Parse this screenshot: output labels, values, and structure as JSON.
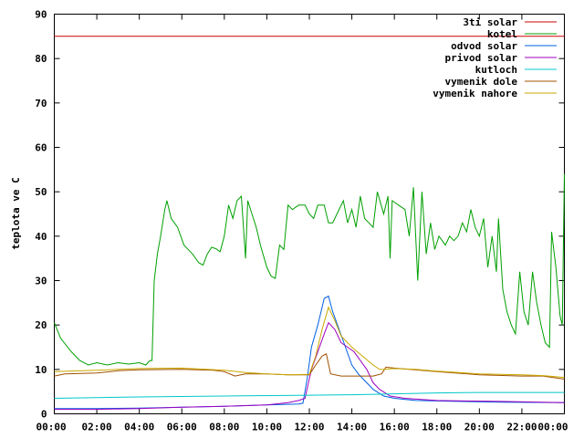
{
  "chart_data": {
    "type": "line",
    "title": "",
    "xlabel": "",
    "ylabel": "teplota ve C",
    "xlim": [
      0,
      24
    ],
    "ylim": [
      0,
      90
    ],
    "grid": false,
    "legend_position": "top-right",
    "x_ticks": [
      {
        "value": 0,
        "label": "00:00"
      },
      {
        "value": 2,
        "label": "02:00"
      },
      {
        "value": 4,
        "label": "04:00"
      },
      {
        "value": 6,
        "label": "06:00"
      },
      {
        "value": 8,
        "label": "08:00"
      },
      {
        "value": 10,
        "label": "10:00"
      },
      {
        "value": 12,
        "label": "12:00"
      },
      {
        "value": 14,
        "label": "14:00"
      },
      {
        "value": 16,
        "label": "16:00"
      },
      {
        "value": 18,
        "label": "18:00"
      },
      {
        "value": 20,
        "label": "20:00"
      },
      {
        "value": 22,
        "label": "22:00"
      },
      {
        "value": 24,
        "label": "00:00"
      }
    ],
    "y_ticks": [
      {
        "value": 0,
        "label": "0"
      },
      {
        "value": 10,
        "label": "10"
      },
      {
        "value": 20,
        "label": "20"
      },
      {
        "value": 30,
        "label": "30"
      },
      {
        "value": 40,
        "label": "40"
      },
      {
        "value": 50,
        "label": "50"
      },
      {
        "value": 60,
        "label": "60"
      },
      {
        "value": 70,
        "label": "70"
      },
      {
        "value": 80,
        "label": "80"
      },
      {
        "value": 90,
        "label": "90"
      }
    ],
    "series": [
      {
        "name": "3ti solar",
        "color": "#cc0000",
        "points": [
          [
            0,
            85
          ],
          [
            24,
            85
          ]
        ]
      },
      {
        "name": "kotel",
        "color": "#00a000",
        "points": [
          [
            0,
            20.5
          ],
          [
            0.3,
            17
          ],
          [
            0.8,
            14
          ],
          [
            1.2,
            12
          ],
          [
            1.6,
            11
          ],
          [
            2,
            11.5
          ],
          [
            2.5,
            11
          ],
          [
            3,
            11.5
          ],
          [
            3.5,
            11.2
          ],
          [
            4,
            11.5
          ],
          [
            4.3,
            11
          ],
          [
            4.5,
            12
          ],
          [
            4.6,
            12
          ],
          [
            4.7,
            30
          ],
          [
            4.85,
            36
          ],
          [
            5,
            40
          ],
          [
            5.2,
            46
          ],
          [
            5.3,
            48
          ],
          [
            5.5,
            44
          ],
          [
            5.8,
            42
          ],
          [
            6.1,
            38
          ],
          [
            6.5,
            36
          ],
          [
            6.8,
            34
          ],
          [
            7,
            33.5
          ],
          [
            7.2,
            36
          ],
          [
            7.4,
            37.5
          ],
          [
            7.6,
            37.2
          ],
          [
            7.8,
            36.5
          ],
          [
            8,
            40
          ],
          [
            8.2,
            47
          ],
          [
            8.4,
            44
          ],
          [
            8.6,
            48
          ],
          [
            8.8,
            49
          ],
          [
            9,
            35
          ],
          [
            9.1,
            48
          ],
          [
            9.3,
            45
          ],
          [
            9.5,
            42
          ],
          [
            9.7,
            38
          ],
          [
            10,
            33
          ],
          [
            10.2,
            31
          ],
          [
            10.4,
            30.5
          ],
          [
            10.6,
            38
          ],
          [
            10.8,
            37
          ],
          [
            11,
            47
          ],
          [
            11.2,
            46
          ],
          [
            11.5,
            47
          ],
          [
            11.8,
            47
          ],
          [
            12,
            45
          ],
          [
            12.2,
            44
          ],
          [
            12.4,
            47
          ],
          [
            12.7,
            47
          ],
          [
            12.9,
            43
          ],
          [
            13.1,
            43
          ],
          [
            13.4,
            46
          ],
          [
            13.6,
            48
          ],
          [
            13.8,
            43
          ],
          [
            14,
            46
          ],
          [
            14.2,
            42
          ],
          [
            14.4,
            49
          ],
          [
            14.6,
            44
          ],
          [
            14.8,
            43
          ],
          [
            15,
            42
          ],
          [
            15.2,
            50
          ],
          [
            15.5,
            45
          ],
          [
            15.7,
            49
          ],
          [
            15.8,
            35
          ],
          [
            15.9,
            48
          ],
          [
            16.2,
            47
          ],
          [
            16.5,
            46
          ],
          [
            16.7,
            40
          ],
          [
            16.9,
            51
          ],
          [
            17.1,
            30
          ],
          [
            17.3,
            50
          ],
          [
            17.5,
            36
          ],
          [
            17.7,
            43
          ],
          [
            17.9,
            37
          ],
          [
            18.1,
            40
          ],
          [
            18.4,
            38
          ],
          [
            18.6,
            40
          ],
          [
            18.8,
            39
          ],
          [
            19,
            40
          ],
          [
            19.2,
            43
          ],
          [
            19.4,
            41
          ],
          [
            19.6,
            46
          ],
          [
            19.8,
            42
          ],
          [
            20,
            40
          ],
          [
            20.2,
            44
          ],
          [
            20.4,
            33
          ],
          [
            20.6,
            40
          ],
          [
            20.8,
            32
          ],
          [
            20.9,
            44
          ],
          [
            21.1,
            28
          ],
          [
            21.3,
            23
          ],
          [
            21.5,
            20
          ],
          [
            21.7,
            18
          ],
          [
            21.9,
            32
          ],
          [
            22.1,
            23
          ],
          [
            22.3,
            20
          ],
          [
            22.5,
            32
          ],
          [
            22.7,
            25
          ],
          [
            22.9,
            20
          ],
          [
            23.1,
            16
          ],
          [
            23.3,
            15
          ],
          [
            23.4,
            41
          ],
          [
            23.6,
            33
          ],
          [
            23.8,
            22
          ],
          [
            23.9,
            20
          ],
          [
            24,
            54
          ]
        ]
      },
      {
        "name": "odvod solar",
        "color": "#0060e0",
        "points": [
          [
            0,
            1.2
          ],
          [
            2,
            1.2
          ],
          [
            4,
            1.3
          ],
          [
            6,
            1.5
          ],
          [
            8,
            1.7
          ],
          [
            10,
            2
          ],
          [
            11.5,
            2.2
          ],
          [
            11.7,
            2.4
          ],
          [
            11.9,
            8
          ],
          [
            12.1,
            15
          ],
          [
            12.4,
            20
          ],
          [
            12.7,
            26
          ],
          [
            12.9,
            26.5
          ],
          [
            13.1,
            23
          ],
          [
            13.4,
            19
          ],
          [
            13.7,
            15
          ],
          [
            14,
            11
          ],
          [
            14.3,
            9
          ],
          [
            14.6,
            7.5
          ],
          [
            15,
            5.5
          ],
          [
            15.5,
            4
          ],
          [
            16,
            3.5
          ],
          [
            17,
            3
          ],
          [
            19,
            2.8
          ],
          [
            21,
            2.6
          ],
          [
            24,
            2.5
          ]
        ]
      },
      {
        "name": "privod solar",
        "color": "#a000c0",
        "points": [
          [
            0,
            1
          ],
          [
            2,
            1
          ],
          [
            4,
            1.2
          ],
          [
            6,
            1.5
          ],
          [
            8,
            1.7
          ],
          [
            10,
            2
          ],
          [
            11,
            2.5
          ],
          [
            11.5,
            3
          ],
          [
            11.8,
            3.5
          ],
          [
            12.1,
            10
          ],
          [
            12.4,
            14
          ],
          [
            12.7,
            18
          ],
          [
            12.9,
            20.5
          ],
          [
            13.2,
            19
          ],
          [
            13.5,
            16
          ],
          [
            13.8,
            15
          ],
          [
            14.1,
            14
          ],
          [
            14.4,
            12
          ],
          [
            14.7,
            10
          ],
          [
            15,
            7
          ],
          [
            15.3,
            5.5
          ],
          [
            15.8,
            4
          ],
          [
            16.5,
            3.5
          ],
          [
            18,
            3
          ],
          [
            21,
            2.8
          ],
          [
            24,
            2.5
          ]
        ]
      },
      {
        "name": "kutloch",
        "color": "#00c8c8",
        "points": [
          [
            0,
            3.5
          ],
          [
            4,
            3.8
          ],
          [
            8,
            4
          ],
          [
            12,
            4.2
          ],
          [
            14,
            4.3
          ],
          [
            16,
            4.5
          ],
          [
            18,
            4.7
          ],
          [
            20,
            4.8
          ],
          [
            22,
            4.8
          ],
          [
            24,
            4.8
          ]
        ]
      },
      {
        "name": "vymenik dole",
        "color": "#a05000",
        "points": [
          [
            0,
            8.5
          ],
          [
            0.5,
            9
          ],
          [
            2,
            9.2
          ],
          [
            3,
            9.7
          ],
          [
            4,
            9.9
          ],
          [
            6,
            10
          ],
          [
            7.5,
            9.8
          ],
          [
            8,
            9.5
          ],
          [
            8.5,
            8.5
          ],
          [
            9,
            9
          ],
          [
            10,
            9
          ],
          [
            11,
            8.8
          ],
          [
            12,
            8.8
          ],
          [
            12.3,
            11
          ],
          [
            12.6,
            13
          ],
          [
            12.8,
            13.5
          ],
          [
            13,
            9
          ],
          [
            13.5,
            8.5
          ],
          [
            14,
            8.5
          ],
          [
            15,
            8.5
          ],
          [
            15.4,
            9
          ],
          [
            15.6,
            10.5
          ],
          [
            16,
            10.3
          ],
          [
            18,
            9.5
          ],
          [
            20,
            8.8
          ],
          [
            22,
            8.5
          ],
          [
            23,
            8.5
          ],
          [
            24,
            7.8
          ]
        ]
      },
      {
        "name": "vymenik nahore",
        "color": "#c8a800",
        "points": [
          [
            0,
            9.5
          ],
          [
            2,
            9.8
          ],
          [
            3,
            10
          ],
          [
            4,
            10.2
          ],
          [
            6,
            10.3
          ],
          [
            8,
            9.8
          ],
          [
            9,
            9.3
          ],
          [
            10,
            9
          ],
          [
            11,
            8.8
          ],
          [
            12,
            8.9
          ],
          [
            12.3,
            13
          ],
          [
            12.6,
            19
          ],
          [
            12.9,
            24
          ],
          [
            13.2,
            21
          ],
          [
            13.5,
            17.5
          ],
          [
            14,
            15
          ],
          [
            14.5,
            13
          ],
          [
            15,
            11
          ],
          [
            15.3,
            10
          ],
          [
            15.5,
            10
          ],
          [
            16,
            10.2
          ],
          [
            17,
            10
          ],
          [
            18,
            9.6
          ],
          [
            20,
            9
          ],
          [
            22,
            8.8
          ],
          [
            23,
            8.6
          ],
          [
            24,
            8.2
          ]
        ]
      }
    ]
  }
}
